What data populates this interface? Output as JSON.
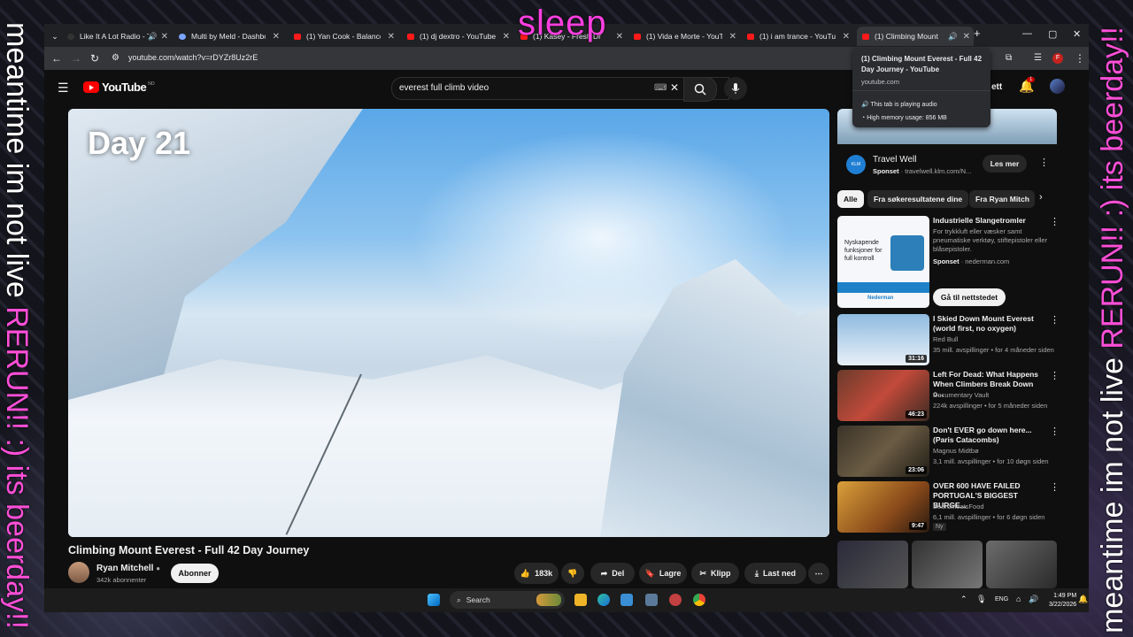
{
  "overlay": {
    "top_text": "sleep",
    "left_white": "meantime im not live ",
    "left_pink": "RERUN!! :) its beerday!!",
    "right_white": "meantime im not live ",
    "right_pink": "RERUN!! :) its beerday!!"
  },
  "browser": {
    "tabs": [
      {
        "label": "Like It A Lot Radio - T",
        "active": false
      },
      {
        "label": "Multi by Meld - Dashboa",
        "active": false
      },
      {
        "label": "(1) Yan Cook - Balance - Y",
        "active": false
      },
      {
        "label": "(1) dj dextro - YouTube",
        "active": false
      },
      {
        "label": "(1) Kasey - Fresh Dr",
        "active": false
      },
      {
        "label": "(1) Vida e Morte - YouTub",
        "active": false
      },
      {
        "label": "(1) i am trance - YouTube",
        "active": false
      },
      {
        "label": "(1) Climbing Mount E",
        "active": true
      }
    ],
    "url": "youtube.com/watch?v=rDYZr8Uz2rE",
    "profile_initial": "F"
  },
  "tooltip": {
    "title": "(1) Climbing Mount Everest - Full 42 Day Journey - YouTube",
    "domain": "youtube.com",
    "audio": "This tab is playing audio",
    "memory": "High memory usage: 856 MB"
  },
  "youtube": {
    "logo": "YouTube",
    "region": "NO",
    "search_query": "everest full climb video",
    "notif_count": "1",
    "header_partial": "ett"
  },
  "video": {
    "overlay_text": "Day 21",
    "title": "Climbing Mount Everest - Full 42 Day Journey",
    "channel": "Ryan Mitchell",
    "subscribers": "342k abonnenter",
    "subscribe_label": "Abonner",
    "like_count": "183k",
    "share_label": "Del",
    "save_label": "Lagre",
    "clip_label": "Klipp",
    "download_label": "Last ned"
  },
  "sidebar": {
    "ad": {
      "title": "Travel Well",
      "sponsored": "Sponset",
      "domain": "travelwell.klm.com/N...",
      "cta": "Les mer",
      "logo": "KLM"
    },
    "chips": [
      "Alle",
      "Fra søkeresultatene dine",
      "Fra Ryan Mitch"
    ],
    "ad2": {
      "title": "Industrielle Slangetromler",
      "desc": "For trykkluft eller væsker samt pneumatiske verktøy, stiftepistoler eller blåsepistoler.",
      "sponsored": "Sponset",
      "domain": "nederman.com",
      "cta": "Gå til nettstedet",
      "thumb_text": "Nyskapende funksjoner for full kontroll",
      "brand": "Nederman"
    },
    "recs": [
      {
        "title": "I Skied Down Mount Everest (world first, no oxygen)",
        "channel": "Red Bull",
        "meta": "35 mill. avspillinger • for 4 måneder siden",
        "duration": "31:16"
      },
      {
        "title": "Left For Dead: What Happens When Climbers Break Down o...",
        "channel": "Documentary Vault",
        "meta": "224k avspillinger • for 5 måneder siden",
        "duration": "46:23"
      },
      {
        "title": "Don't EVER go down here... (Paris Catacombs)",
        "channel": "Magnus Midtbø",
        "meta": "3,1 mill. avspillinger • for 10 døgn siden",
        "duration": "23:06"
      },
      {
        "title": "OVER 600 HAVE FAILED PORTUGAL'S BIGGEST BURGE...",
        "channel": "BeardMeatsFood",
        "meta": "6,1 mill. avspillinger • for 6 døgn siden",
        "duration": "9:47",
        "badge": "Ny"
      }
    ]
  },
  "taskbar": {
    "search": "Search",
    "lang": "ENG",
    "time": "1:49 PM",
    "date": "3/22/2026"
  }
}
